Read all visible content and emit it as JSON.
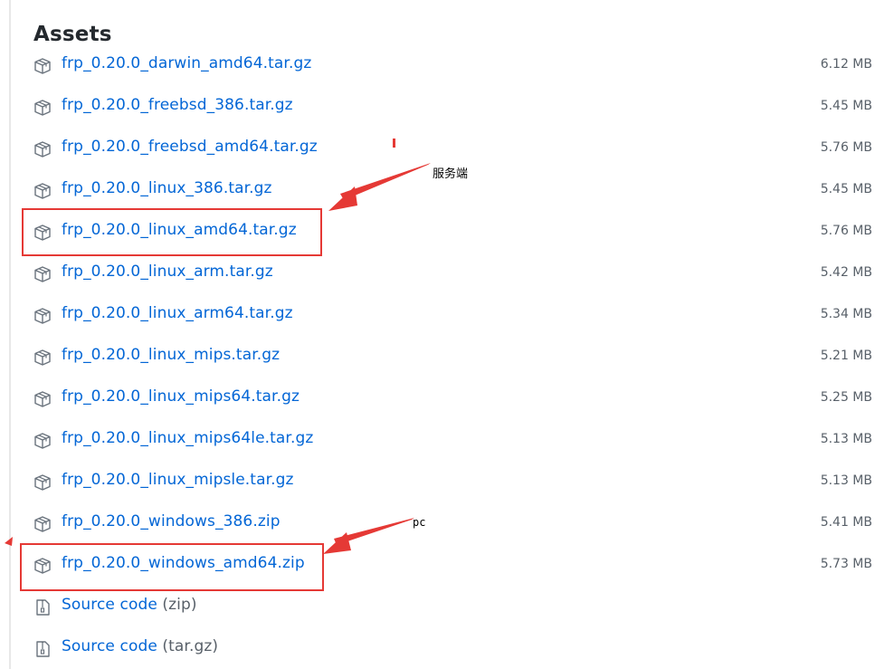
{
  "title": "Assets",
  "assets": [
    {
      "name": "frp_0.20.0_darwin_amd64.tar.gz",
      "size": "6.12 MB"
    },
    {
      "name": "frp_0.20.0_freebsd_386.tar.gz",
      "size": "5.45 MB"
    },
    {
      "name": "frp_0.20.0_freebsd_amd64.tar.gz",
      "size": "5.76 MB"
    },
    {
      "name": "frp_0.20.0_linux_386.tar.gz",
      "size": "5.45 MB"
    },
    {
      "name": "frp_0.20.0_linux_amd64.tar.gz",
      "size": "5.76 MB"
    },
    {
      "name": "frp_0.20.0_linux_arm.tar.gz",
      "size": "5.42 MB"
    },
    {
      "name": "frp_0.20.0_linux_arm64.tar.gz",
      "size": "5.34 MB"
    },
    {
      "name": "frp_0.20.0_linux_mips.tar.gz",
      "size": "5.21 MB"
    },
    {
      "name": "frp_0.20.0_linux_mips64.tar.gz",
      "size": "5.25 MB"
    },
    {
      "name": "frp_0.20.0_linux_mips64le.tar.gz",
      "size": "5.13 MB"
    },
    {
      "name": "frp_0.20.0_linux_mipsle.tar.gz",
      "size": "5.13 MB"
    },
    {
      "name": "frp_0.20.0_windows_386.zip",
      "size": "5.41 MB"
    },
    {
      "name": "frp_0.20.0_windows_amd64.zip",
      "size": "5.73 MB"
    }
  ],
  "source_code": [
    {
      "label": "Source code",
      "format": "(zip)"
    },
    {
      "label": "Source code",
      "format": "(tar.gz)"
    }
  ],
  "annotations": {
    "server_label": "服务端",
    "pc_label": "pc",
    "color": "#e53935"
  },
  "icons": {
    "package": "package-icon",
    "file_zip": "file-zip-icon"
  },
  "colors": {
    "link": "#0366d6",
    "muted": "#586069",
    "heading": "#24292e"
  }
}
